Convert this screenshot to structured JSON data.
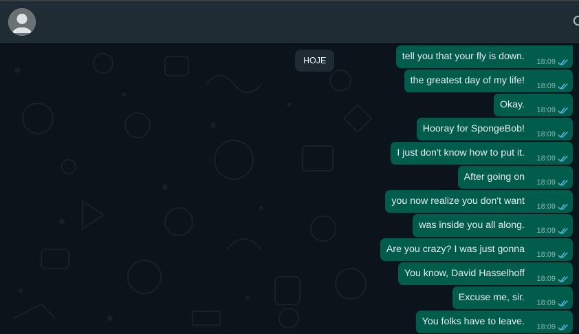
{
  "chat": {
    "date_label": "HOJE",
    "messages": [
      {
        "text": "tell you that your fly is down.",
        "time": "18:09",
        "status": "read"
      },
      {
        "text": "the greatest day of my life!",
        "time": "18:09",
        "status": "read"
      },
      {
        "text": "Okay.",
        "time": "18:09",
        "status": "read"
      },
      {
        "text": "Hooray for SpongeBob!",
        "time": "18:09",
        "status": "read"
      },
      {
        "text": "I just don't know how to put it.",
        "time": "18:09",
        "status": "read"
      },
      {
        "text": "After going on",
        "time": "18:09",
        "status": "read"
      },
      {
        "text": "you now realize you don't want",
        "time": "18:09",
        "status": "read"
      },
      {
        "text": "was inside you all along.",
        "time": "18:09",
        "status": "read"
      },
      {
        "text": "Are you crazy? I was just gonna",
        "time": "18:09",
        "status": "read"
      },
      {
        "text": "You know, David Hasselhoff",
        "time": "18:09",
        "status": "read"
      },
      {
        "text": "Excuse me, sir.",
        "time": "18:09",
        "status": "read"
      },
      {
        "text": "You folks have to leave.",
        "time": "18:09",
        "status": "read"
      }
    ]
  },
  "colors": {
    "header_bg": "#202c33",
    "chat_bg": "#0b141a",
    "outgoing_bubble": "#005c4b",
    "read_tick": "#53bdeb",
    "text": "#e9edef"
  },
  "icons": {
    "avatar": "default-avatar-icon",
    "header_right": "search-icon",
    "read_receipt": "double-check-icon"
  }
}
